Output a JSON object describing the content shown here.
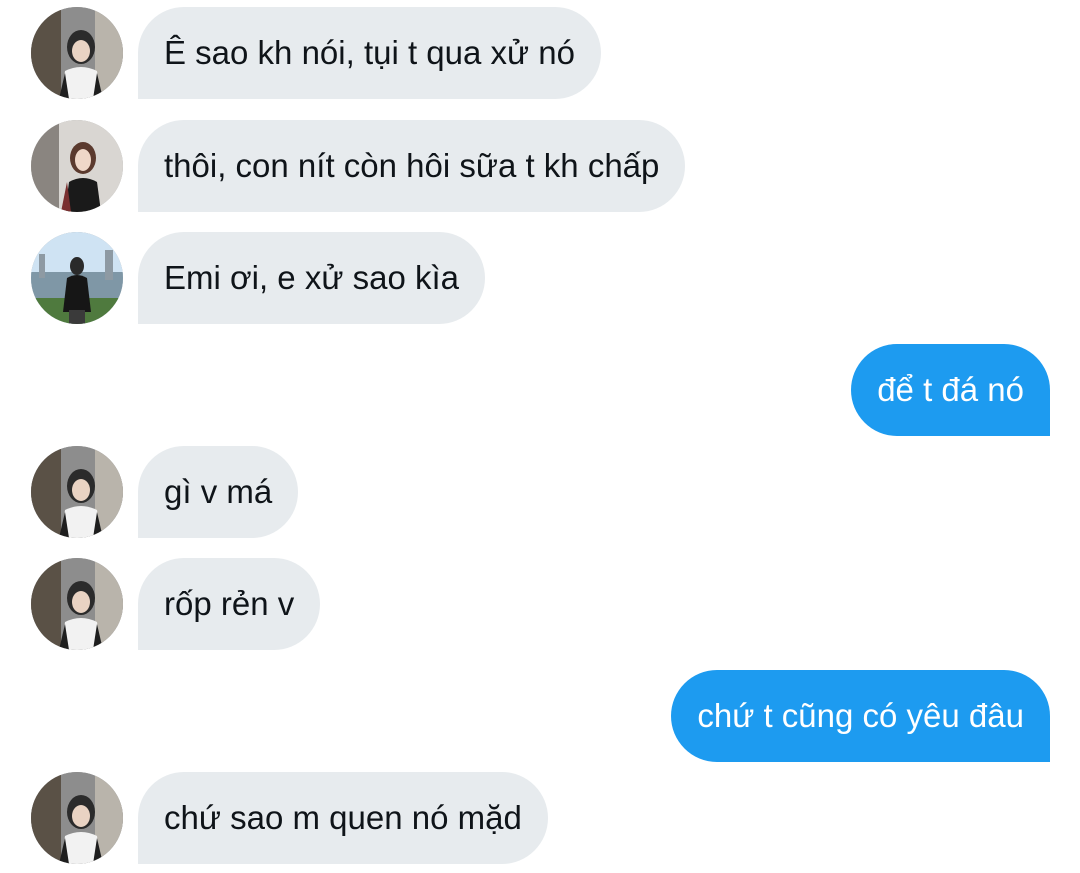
{
  "messages": [
    {
      "direction": "incoming",
      "avatar": "avatar-a",
      "text": "Ê sao kh nói, tụi t qua xử nó"
    },
    {
      "direction": "incoming",
      "avatar": "avatar-b",
      "text": "thôi, con nít còn hôi sữa t kh chấp"
    },
    {
      "direction": "incoming",
      "avatar": "avatar-c",
      "text": "Emi ơi, e xử sao kìa"
    },
    {
      "direction": "outgoing",
      "text": "để t đá nó"
    },
    {
      "direction": "incoming",
      "avatar": "avatar-a",
      "text": "gì v má"
    },
    {
      "direction": "incoming",
      "avatar": "avatar-a",
      "text": "rốp rẻn v"
    },
    {
      "direction": "outgoing",
      "text": "chứ t cũng có yêu đâu"
    },
    {
      "direction": "incoming",
      "avatar": "avatar-a",
      "text": "chứ sao m quen nó mặd"
    }
  ],
  "colors": {
    "incoming_bubble": "#e7ebee",
    "outgoing_bubble": "#1d9bf0",
    "incoming_text": "#0f1419",
    "outgoing_text": "#ffffff"
  }
}
